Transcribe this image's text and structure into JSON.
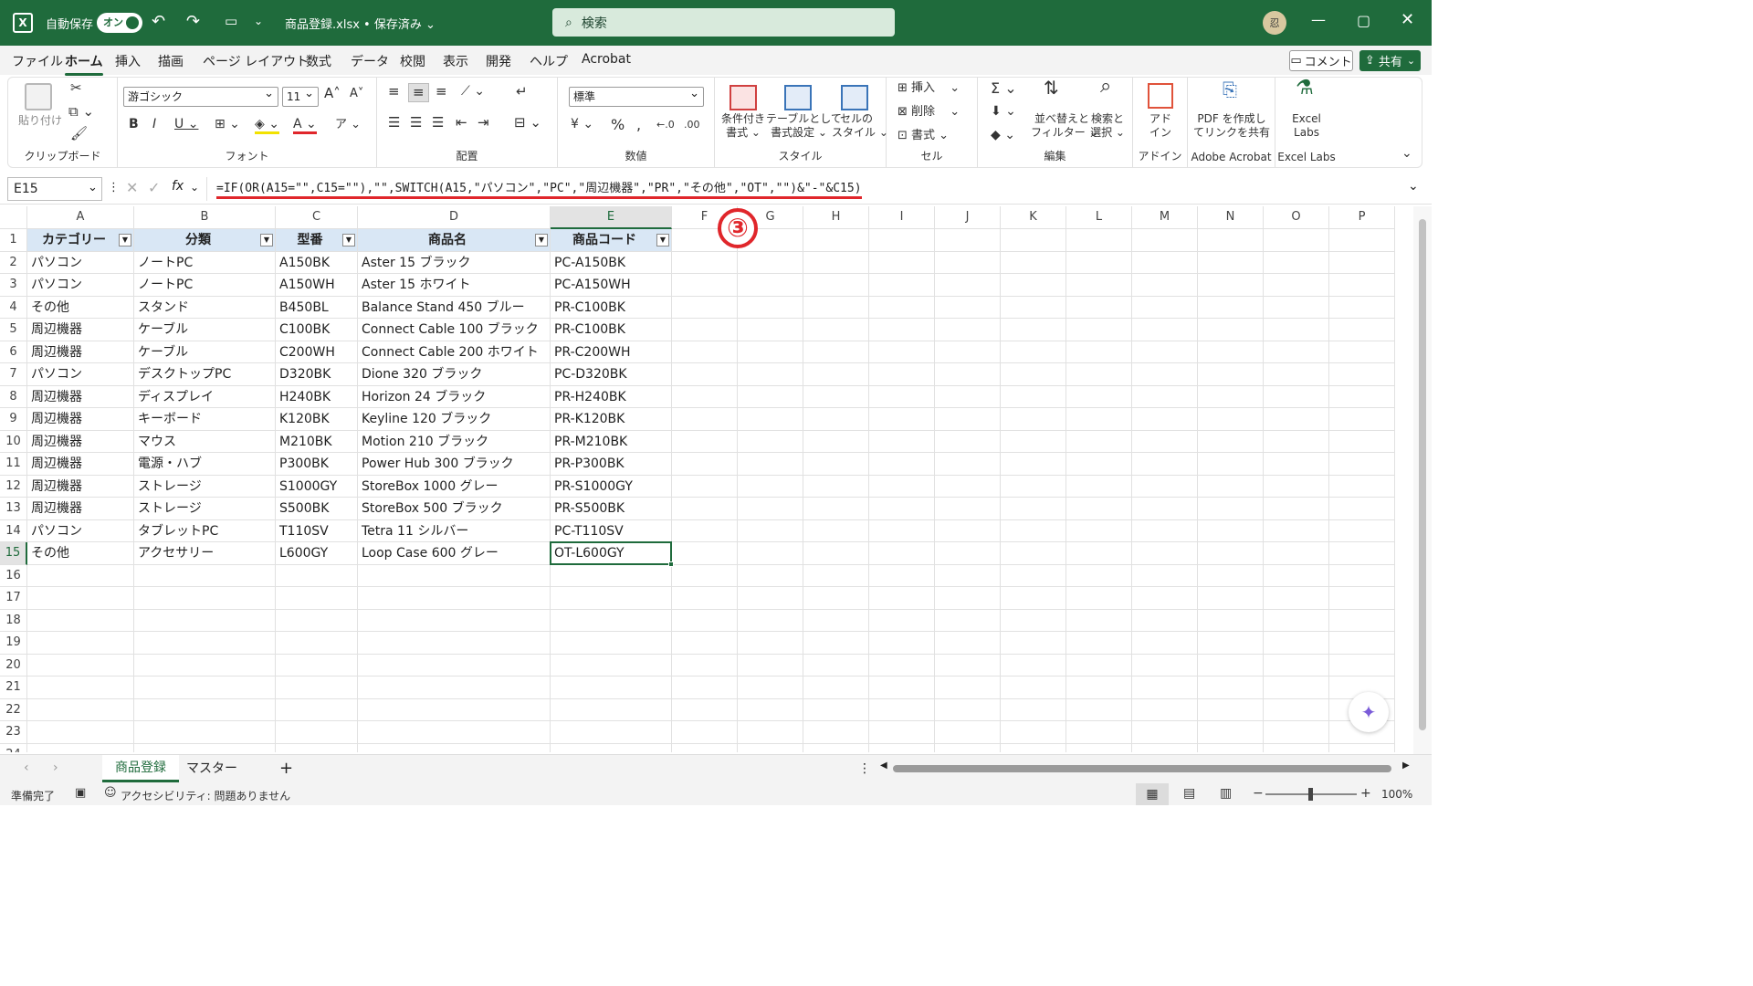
{
  "title": {
    "autosave_label": "自動保存",
    "autosave_state": "オン",
    "filename": "商品登録.xlsx • 保存済み ⌄",
    "search_placeholder": "検索"
  },
  "menu": {
    "items": [
      "ファイル",
      "ホーム",
      "挿入",
      "描画",
      "ページ レイアウト",
      "数式",
      "データ",
      "校閲",
      "表示",
      "開発",
      "ヘルプ",
      "Acrobat"
    ],
    "active": "ホーム",
    "comment": "コメント",
    "share": "共有"
  },
  "ribbon": {
    "clipboard": {
      "label": "クリップボード",
      "paste": "貼り付け"
    },
    "font": {
      "label": "フォント",
      "name": "游ゴシック",
      "size": "11"
    },
    "align": {
      "label": "配置"
    },
    "number": {
      "label": "数値",
      "format": "標準"
    },
    "style": {
      "label": "スタイル",
      "cond": "条件付き\n書式 ⌄",
      "table": "テーブルとして\n書式設定 ⌄",
      "cell": "セルの\nスタイル ⌄"
    },
    "cells": {
      "label": "セル",
      "insert": "挿入",
      "delete": "削除",
      "format": "書式"
    },
    "edit": {
      "label": "編集",
      "sort": "並べ替えと\nフィルター ⌄",
      "find": "検索と\n選択 ⌄"
    },
    "addin": {
      "label": "アドイン",
      "btn": "アド\nイン"
    },
    "acrobat": {
      "label": "Adobe Acrobat",
      "btn": "PDF を作成し\nてリンクを共有"
    },
    "labs": {
      "label": "Excel Labs",
      "btn": "Excel\nLabs"
    }
  },
  "formula_bar": {
    "name_box": "E15",
    "fx": "fx",
    "formula": "=IF(OR(A15=\"\",C15=\"\"),\"\",SWITCH(A15,\"パソコン\",\"PC\",\"周辺機器\",\"PR\",\"その他\",\"OT\",\"\")&\"-\"&C15)",
    "annotation": "③"
  },
  "grid": {
    "columns": [
      "A",
      "B",
      "C",
      "D",
      "E",
      "F",
      "G",
      "H",
      "I",
      "J",
      "K",
      "L",
      "M",
      "N",
      "O",
      "P"
    ],
    "rows": [
      "1",
      "2",
      "3",
      "4",
      "5",
      "6",
      "7",
      "8",
      "9",
      "10",
      "11",
      "12",
      "13",
      "14",
      "15",
      "16",
      "17",
      "18",
      "19",
      "20",
      "21",
      "22",
      "23",
      "24"
    ],
    "headers": [
      "カテゴリー",
      "分類",
      "型番",
      "商品名",
      "商品コード"
    ],
    "data": [
      [
        "パソコン",
        "ノートPC",
        "A150BK",
        "Aster 15 ブラック",
        "PC-A150BK"
      ],
      [
        "パソコン",
        "ノートPC",
        "A150WH",
        "Aster 15 ホワイト",
        "PC-A150WH"
      ],
      [
        "その他",
        "スタンド",
        "B450BL",
        "Balance Stand 450 ブルー",
        "PR-C100BK"
      ],
      [
        "周辺機器",
        "ケーブル",
        "C100BK",
        "Connect Cable 100 ブラック",
        "PR-C100BK"
      ],
      [
        "周辺機器",
        "ケーブル",
        "C200WH",
        "Connect Cable 200 ホワイト",
        "PR-C200WH"
      ],
      [
        "パソコン",
        "デスクトップPC",
        "D320BK",
        "Dione 320 ブラック",
        "PC-D320BK"
      ],
      [
        "周辺機器",
        "ディスプレイ",
        "H240BK",
        "Horizon 24 ブラック",
        "PR-H240BK"
      ],
      [
        "周辺機器",
        "キーボード",
        "K120BK",
        "Keyline 120 ブラック",
        "PR-K120BK"
      ],
      [
        "周辺機器",
        "マウス",
        "M210BK",
        "Motion 210 ブラック",
        "PR-M210BK"
      ],
      [
        "周辺機器",
        "電源・ハブ",
        "P300BK",
        "Power Hub 300 ブラック",
        "PR-P300BK"
      ],
      [
        "周辺機器",
        "ストレージ",
        "S1000GY",
        "StoreBox 1000 グレー",
        "PR-S1000GY"
      ],
      [
        "周辺機器",
        "ストレージ",
        "S500BK",
        "StoreBox 500 ブラック",
        "PR-S500BK"
      ],
      [
        "パソコン",
        "タブレットPC",
        "T110SV",
        "Tetra 11 シルバー",
        "PC-T110SV"
      ],
      [
        "その他",
        "アクセサリー",
        "L600GY",
        "Loop Case 600 グレー",
        "OT-L600GY"
      ]
    ]
  },
  "tabs": {
    "sheets": [
      "商品登録",
      "マスター"
    ],
    "active": "商品登録",
    "add": "+"
  },
  "status": {
    "ready": "準備完了",
    "accessibility": "アクセシビリティ: 問題ありません",
    "zoom": "100%"
  },
  "colors": {
    "accent": "#1f6b3c",
    "header_fill": "#d9e7f5",
    "annotation": "#e0262b"
  }
}
